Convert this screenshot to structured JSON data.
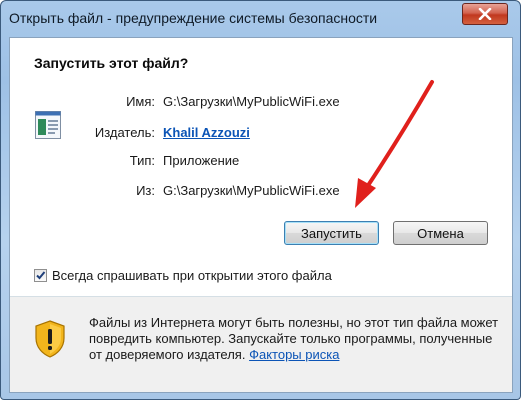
{
  "window": {
    "title": "Открыть файл - предупреждение системы безопасности",
    "close_icon": "close-icon"
  },
  "dialog": {
    "question": "Запустить этот файл?",
    "fields": {
      "name_label": "Имя:",
      "name_value": "G:\\Загрузки\\MyPublicWiFi.exe",
      "publisher_label": "Издатель:",
      "publisher_value": "Khalil Azzouzi",
      "type_label": "Тип:",
      "type_value": "Приложение",
      "from_label": "Из:",
      "from_value": "G:\\Загрузки\\MyPublicWiFi.exe"
    },
    "buttons": {
      "run": "Запустить",
      "cancel": "Отмена"
    },
    "always_ask": {
      "label": "Всегда спрашивать при открытии этого файла",
      "checked": true
    },
    "warning": {
      "text": "Файлы из Интернета могут быть полезны, но этот тип файла может повредить компьютер. Запускайте только программы, полученные от доверяемого издателя.",
      "link": "Факторы риска"
    }
  },
  "colors": {
    "arrow": "#e0201c",
    "link": "#0b54b6"
  }
}
